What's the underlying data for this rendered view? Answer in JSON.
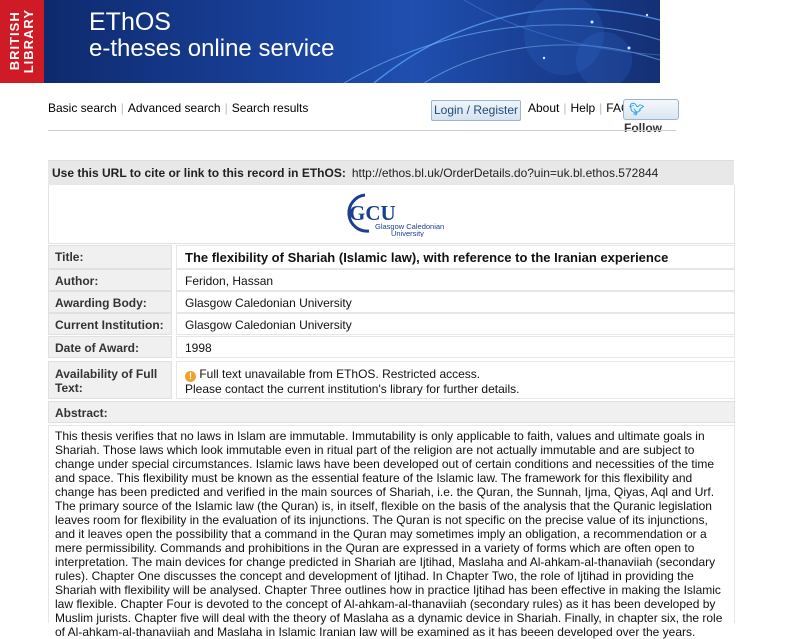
{
  "banner": {
    "library_logo": "BRITISH\nLIBRARY",
    "title": "EThOS",
    "subtitle": "e-theses online service"
  },
  "nav": {
    "basic_search": "Basic search",
    "advanced_search": "Advanced search",
    "search_results": "Search results",
    "login_register": "Login / Register",
    "about": "About",
    "help": "Help",
    "faq": "FAQ",
    "follow": "Follow"
  },
  "record": {
    "url_label": "Use this URL to cite or link to this record in EThOS:",
    "url": "http://ethos.bl.uk/OrderDetails.do?uin=uk.bl.ethos.572844",
    "institution_logo": {
      "acronym": "GCU",
      "name_line1": "Glasgow Caledonian",
      "name_line2": "University"
    },
    "fields": {
      "title_label": "Title:",
      "title": "The flexibility of Shariah (Islamic law), with reference to the Iranian experience",
      "author_label": "Author:",
      "author": "Feridon, Hassan",
      "awarding_body_label": "Awarding Body:",
      "awarding_body": "Glasgow Caledonian University",
      "current_institution_label": "Current Institution:",
      "current_institution": "Glasgow Caledonian University",
      "date_label": "Date of Award:",
      "date": "1998",
      "availability_label": "Availability of Full Text:",
      "availability_line1": "Full text unavailable from EThOS. Restricted access.",
      "availability_line2": "Please contact the current institution's library for further details.",
      "abstract_label": "Abstract:",
      "abstract": "This thesis verifies that no laws in Islam are immutable. Immutability is only applicable to faith, values and ultimate goals in Shariah. Those laws which look immutable even in ritual part of the religion are not actually immutable and are subject to change under special circumstances. Islamic laws have been developed out of certain conditions and necessities of the time and space. This flexibility must be known as the essential feature of the Islamic law. The framework for this flexibility and change has been predicted and verified in the main sources of Shariah, i.e. the Quran, the Sunnah, Ijma, Qiyas, Aql and Urf. The primary source of the Islamic law (the Quran) is, in itself, flexible on the basis of the analysis that the Quranic legislation leaves room for flexibility in the evaluation of its injunctions. The Quran is not specific on the precise value of its injunctions, and it leaves open the possibility that a command in the Quran may sometimes imply an obligation, a recommendation or a mere permissibility. Commands and prohibitions in the Quran are expressed in a variety of forms which are often open to interpretation. The main devices for change predicted in Shariah are Ijtihad, Maslaha and Al-ahkam-al-thanaviiah (secondary rules). Chapter One discusses the concept and development of Ijtihad. In Chapter Two, the role of Ijtihad in providing the Shariah with flexibility will be analysed. Chapter Three outlines how in practice Ijtihad has been effective in making the Islamic law flexible. Chapter Four is devoted to the concept of Al-ahkam-al-thanaviiah (secondary rules) as it has been developed by Muslim jurists. Chapter five will deal with the theory of Maslaha as a dynamic device in Shariah. Finally, in chapter six, the role of Al-ahkam-al-thanaviiah and Maslaha in Islamic Iranian law will be examined as it has beeen developed over the years."
    }
  },
  "icons": {
    "warning": "warning-icon",
    "twitter": "twitter-bird-icon"
  },
  "colors": {
    "library_red": "#cf1b26",
    "banner_blue": "#183f96",
    "label_bg": "#f0f0f0",
    "url_bar_bg": "#e8e8e8",
    "warning_orange": "#f0a030",
    "twitter_blue": "#2aa3ef",
    "gcu_blue": "#1b3f8f"
  }
}
